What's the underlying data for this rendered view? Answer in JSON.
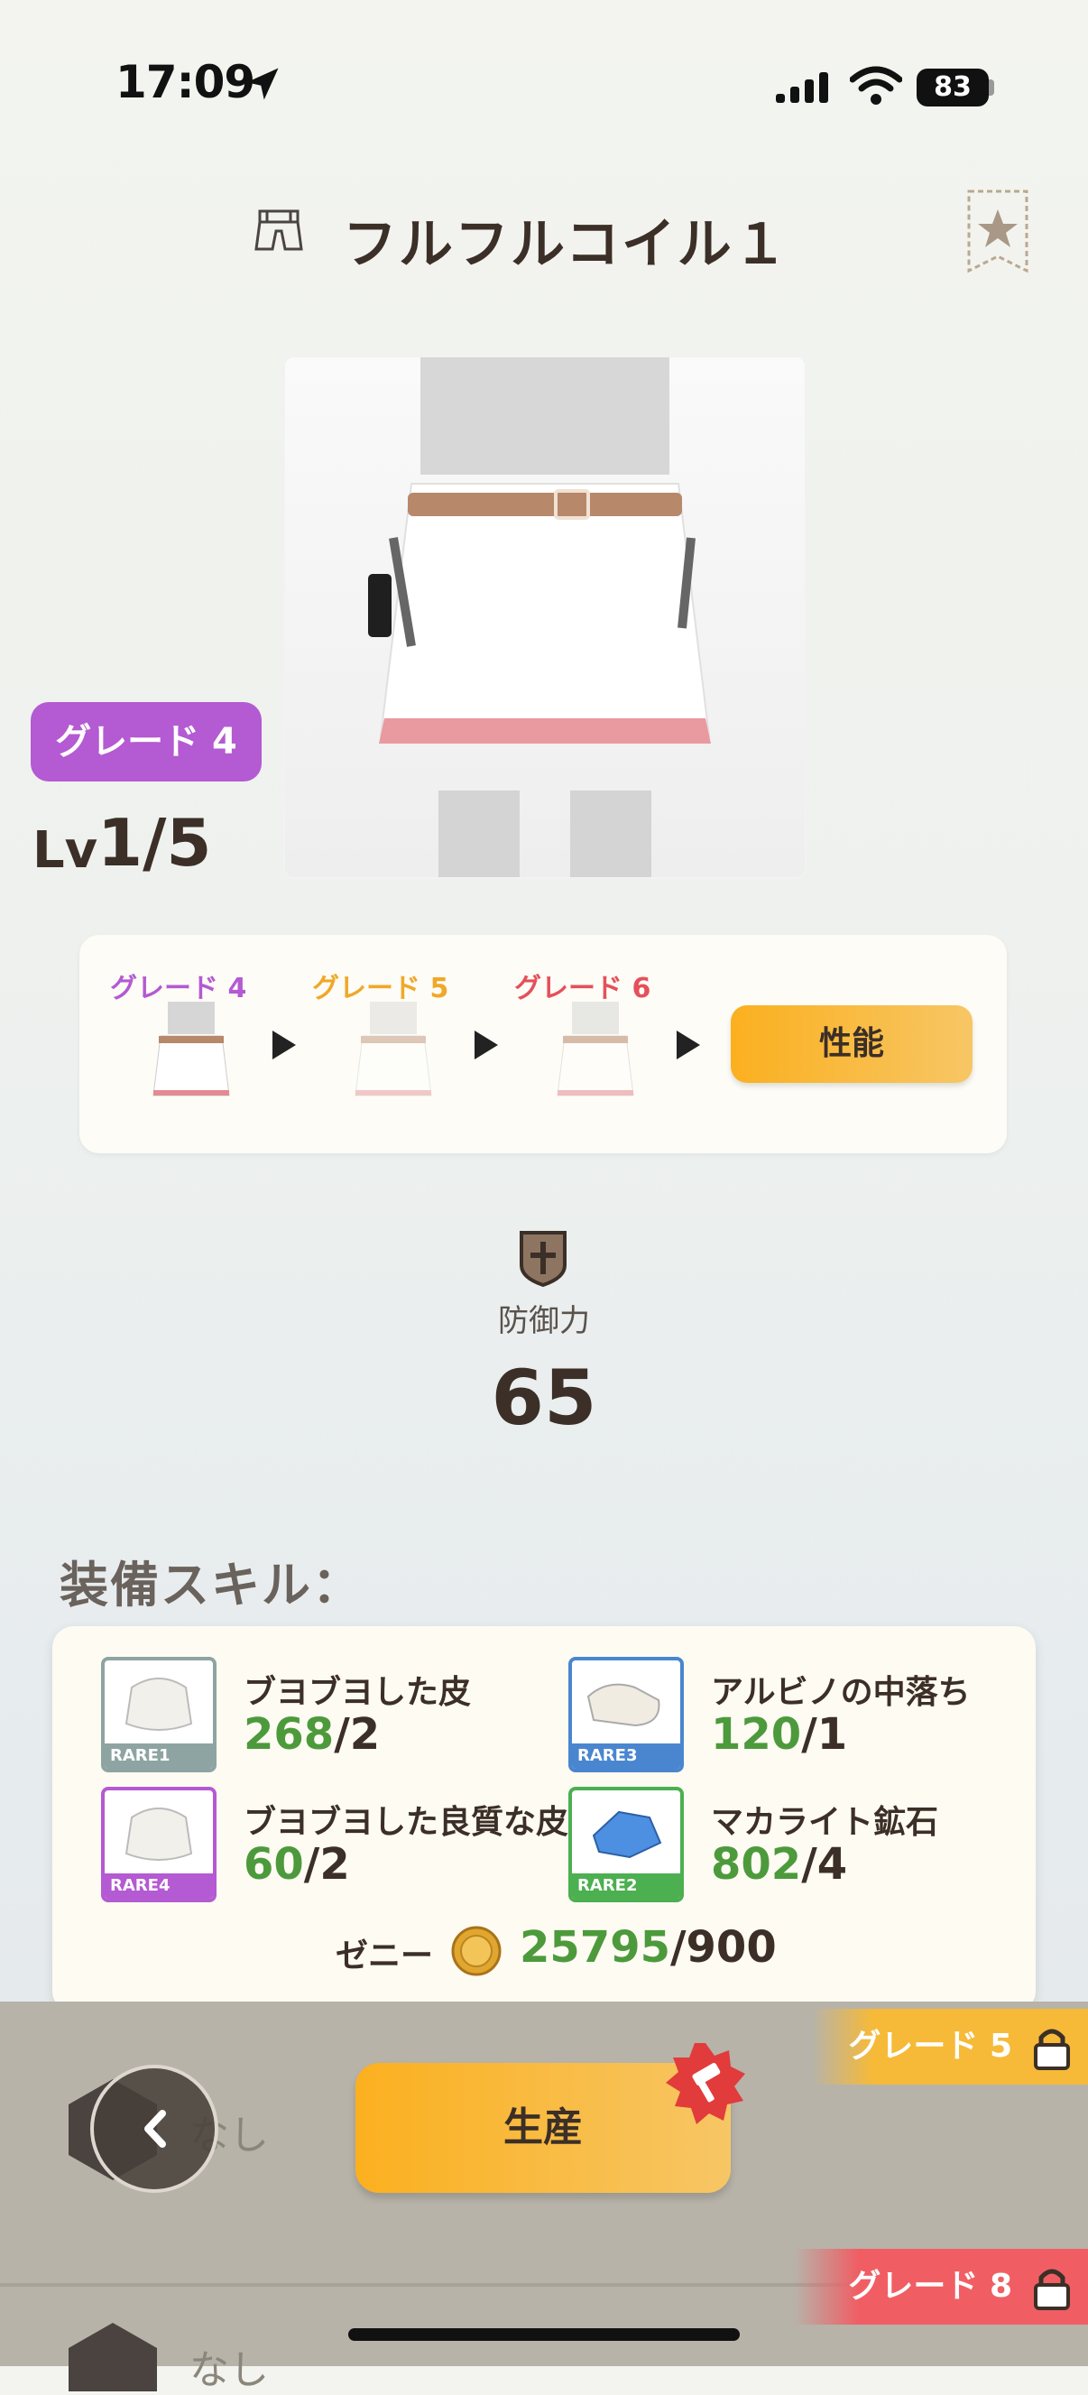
{
  "status_bar": {
    "time": "17:09",
    "battery": "83"
  },
  "header": {
    "title": "フルフルコイル１",
    "armor_icon": "waist-armor-icon",
    "favorite_icon": "star-bookmark-icon"
  },
  "grade": {
    "label": "グレード 4",
    "level_prefix": "Lv",
    "level_value": "1/5"
  },
  "upgrade_path": {
    "steps": [
      {
        "label": "グレード 4",
        "color": "#b45ad2"
      },
      {
        "label": "グレード 5",
        "color": "#f0a82a"
      },
      {
        "label": "グレード 6",
        "color": "#e5505a"
      }
    ],
    "button_label": "性能"
  },
  "defense": {
    "label": "防御力",
    "value": "65",
    "icon": "shield-icon"
  },
  "skills": {
    "heading": "装備スキル："
  },
  "materials": [
    {
      "name": "ブヨブヨした皮",
      "have": "268",
      "need": "/2",
      "rarity": "RARE1",
      "rarity_color": "#8ea4a2"
    },
    {
      "name": "アルビノの中落ち",
      "have": "120",
      "need": "/1",
      "rarity": "RARE3",
      "rarity_color": "#4a86cf"
    },
    {
      "name": "ブヨブヨした良質な皮",
      "have": "60",
      "need": "/2",
      "rarity": "RARE4",
      "rarity_color": "#b45ad2"
    },
    {
      "name": "マカライト鉱石",
      "have": "802",
      "need": "/4",
      "rarity": "RARE2",
      "rarity_color": "#4caf50"
    }
  ],
  "zeny": {
    "label": "ゼニー",
    "have": "25795",
    "need": "/900"
  },
  "bottom": {
    "slot_1": "なし",
    "slot_2": "なし",
    "produce_label": "生産",
    "tier_5_label": "グレード 5",
    "tier_8_label": "グレード 8"
  },
  "colors": {
    "accent": "#fbb01f",
    "have_green": "#4d9a3c"
  }
}
